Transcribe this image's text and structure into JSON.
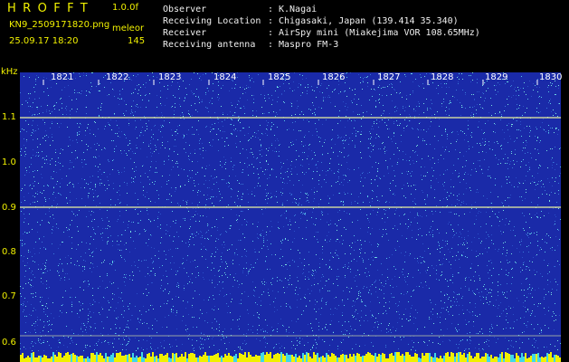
{
  "header": {
    "app_title": "HROFFT",
    "version": "1.0.0f",
    "file_name": "KN9_2509171820.png",
    "mode": "meleor",
    "datetime": "25.09.17 18:20",
    "count": "145"
  },
  "info": [
    {
      "key": "Observer",
      "value": "K.Nagai"
    },
    {
      "key": "Receiving Location",
      "value": "Chigasaki, Japan (139.414 35.340)"
    },
    {
      "key": "Receiver",
      "value": "AirSpy mini (Miakejima VOR 108.65MHz)"
    },
    {
      "key": "Receiving antenna",
      "value": "Maspro FM-3"
    }
  ],
  "spectrogram": {
    "freq_unit": "kHz",
    "y_ticks": [
      "1.1",
      "1.0",
      "0.9",
      "0.8",
      "0.7",
      "0.6"
    ],
    "time_ticks": [
      "1821",
      "1822",
      "1823",
      "1824",
      "1825",
      "1826",
      "1827",
      "1828",
      "1829",
      "1830"
    ],
    "carrier_freqs_khz": [
      1.1,
      0.9
    ],
    "background_color": "#1a2aa8",
    "speckle_color": "#5ac8e8",
    "line_color": "#e8f0a0",
    "bottom_strip_color": "#f0f000"
  }
}
